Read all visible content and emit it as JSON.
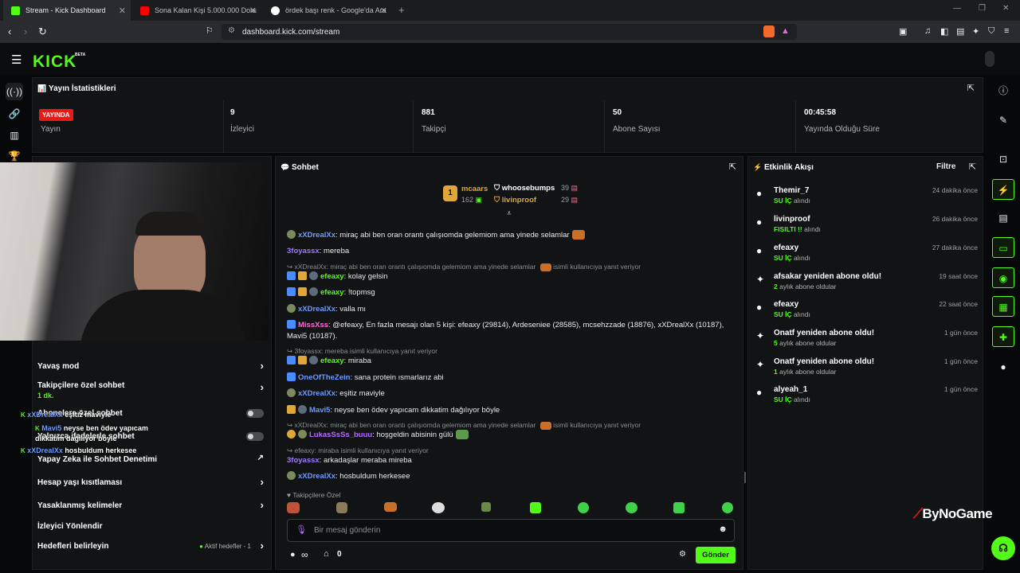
{
  "browser": {
    "tabs": [
      {
        "title": "Stream - Kick Dashboard"
      },
      {
        "title": "Sona Kalan Kişi 5.000.000 Dolar Kaza"
      },
      {
        "title": "ördek başı renk - Google'da Ara"
      }
    ],
    "url": "dashboard.kick.com/stream"
  },
  "header": {
    "logo": "KICK",
    "beta": "BETA"
  },
  "stats": {
    "title": "Yayın İstatistikleri",
    "items": [
      {
        "value": "YAYINDA",
        "label": "Yayın"
      },
      {
        "value": "9",
        "label": "İzleyici"
      },
      {
        "value": "881",
        "label": "Takipçi"
      },
      {
        "value": "50",
        "label": "Abone Sayısı"
      },
      {
        "value": "00:45:58",
        "label": "Yayında Olduğu Süre"
      }
    ]
  },
  "settings": {
    "rows": [
      {
        "label": "Yavaş mod"
      },
      {
        "label": "Takipçilere özel sohbet",
        "sub": "1 dk."
      },
      {
        "label": "Abonelere özel sohbet"
      },
      {
        "label": "Yalnızca ifadelerle sohbet"
      },
      {
        "label": "Yapay Zeka ile Sohbet Denetimi"
      },
      {
        "label": "Hesap yaşı kısıtlaması"
      },
      {
        "label": "Yasaklanmış kelimeler"
      },
      {
        "label": "İzleyici Yönlendir"
      },
      {
        "label": "Hedefleri belirleyin",
        "sub": "Aktif hedefler - 1"
      }
    ]
  },
  "overlay": {
    "lines": [
      {
        "user": "xXDrealXx",
        "text": "eşitiz maviyle"
      },
      {
        "user": "Mavi5",
        "text": "neyse ben ödev yapıcam dikkatim dağılıyor böyle"
      },
      {
        "user": "xXDrealXx",
        "text": "hosbuldum herkesee"
      }
    ]
  },
  "chat": {
    "title": "Sohbet",
    "top": [
      {
        "name": "mcaars",
        "count": "162"
      },
      {
        "name": "whoosebumps",
        "count": "39"
      },
      {
        "name": "livinproof",
        "count": "29"
      }
    ],
    "rank": "1",
    "messages": [
      {
        "user": "xXDrealXx",
        "text": ": miraç abi ben oran orantı çalışıomda gelemiom ama yinede selamlar"
      },
      {
        "user": "3foyassx",
        "text": ": mereba"
      },
      {
        "reply": "xXDrealXx: miraç abi ben oran orantı çalışıomda gelemiom ama yinede selamlar",
        "reply_suffix": "isimli kullanıcıya yanıt veriyor"
      },
      {
        "user": "efeaxy",
        "text": ": kolay gelsin"
      },
      {
        "user": "efeaxy",
        "text": ": !topmsg"
      },
      {
        "user": "xXDrealXx",
        "text": ": valla mı"
      },
      {
        "user": "MissXss",
        "text": ": @efeaxy, En fazla mesajı olan 5 kişi: efeaxy (29814), Ardeseniee (28585), mcsehzzade (18876), xXDrealXx (10187), Mavi5 (10187)."
      },
      {
        "reply": "3foyassx: mereba isimli kullanıcıya yanıt veriyor"
      },
      {
        "user": "efeaxy",
        "text": ": miraba"
      },
      {
        "user": "OneOfTheZein",
        "text": ": sana protein ısmarlarız abi"
      },
      {
        "user": "xXDrealXx",
        "text": ": eşitiz maviyle"
      },
      {
        "user": "Mavi5",
        "text": ": neyse ben ödev yapıcam dikkatim dağılıyor böyle"
      },
      {
        "reply": "xXDrealXx: miraç abi ben oran orantı çalışıomda gelemiom ama yinede selamlar",
        "reply_suffix": "isimli kullanıcıya yanıt veriyor"
      },
      {
        "user": "LukasSsSs_buuu",
        "text": ": hoşgeldin abisinin gülü"
      },
      {
        "reply": "efeaxy: miraba isimli kullanıcıya yanıt veriyor"
      },
      {
        "user": "3foyassx",
        "text": ": arkadaşlar meraba mireba"
      },
      {
        "user": "xXDrealXx",
        "text": ": hosbuldum herkesee"
      }
    ],
    "followers_only": "Takipçilere Özel",
    "input_placeholder": "Bir mesaj gönderin",
    "points": "∞",
    "store_count": "0",
    "send_label": "Gönder"
  },
  "feed": {
    "title": "Etkinlik Akışı",
    "filter_label": "Filtre",
    "items": [
      {
        "name": "Themir_7",
        "sub_highlight": "SU İÇ",
        "sub": "alındı",
        "time": "24 dakika önce",
        "icon": "points-icon"
      },
      {
        "name": "livinproof",
        "sub_highlight": "FISILTI !!",
        "sub": "alındı",
        "time": "26 dakika önce",
        "icon": "points-icon"
      },
      {
        "name": "efeaxy",
        "sub_highlight": "SU İÇ",
        "sub": "alındı",
        "time": "27 dakika önce",
        "icon": "points-icon"
      },
      {
        "name": "afsakar yeniden abone oldu!",
        "sub_highlight": "2",
        "sub": "aylık abone oldular",
        "time": "19 saat önce",
        "icon": "sparkle-icon"
      },
      {
        "name": "efeaxy",
        "sub_highlight": "SU İÇ",
        "sub": "alındı",
        "time": "22 saat önce",
        "icon": "points-icon"
      },
      {
        "name": "Onatf yeniden abone oldu!",
        "sub_highlight": "5",
        "sub": "aylık abone oldular",
        "time": "1 gün önce",
        "icon": "sparkle-icon"
      },
      {
        "name": "Onatf yeniden abone oldu!",
        "sub_highlight": "1",
        "sub": "aylık abone oldular",
        "time": "1 gün önce",
        "icon": "sparkle-icon"
      },
      {
        "name": "alyeah_1",
        "sub_highlight": "SU İÇ",
        "sub": "alındı",
        "time": "1 gün önce",
        "icon": "points-icon"
      }
    ]
  },
  "watermark": "ByNoGame",
  "colors": {
    "kick_green": "#53fc18",
    "live_red": "#e91916",
    "panel": "#111314"
  }
}
